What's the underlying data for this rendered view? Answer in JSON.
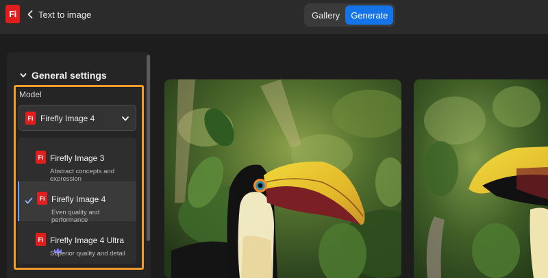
{
  "header": {
    "logo_text": "Fi",
    "title": "Text to image",
    "tabs": [
      {
        "label": "Gallery",
        "active": false
      },
      {
        "label": "Generate",
        "active": true
      }
    ]
  },
  "settings": {
    "section_title": "General settings",
    "model_label": "Model",
    "selected_model": "Firefly Image 4",
    "options": [
      {
        "name": "Firefly Image 3",
        "description": "Abstract concepts and expression",
        "selected": false
      },
      {
        "name": "Firefly Image 4",
        "description": "Even quality and performance",
        "selected": true
      },
      {
        "name": "Firefly Image 4 Ultra",
        "description": "Superior quality and detail",
        "selected": false,
        "premium_icon": "crown-icon"
      }
    ]
  },
  "colors": {
    "accent": "#1473e6",
    "brand": "#e01e1e",
    "highlight_border": "#f39a2d",
    "premium": "#7b7bf5"
  },
  "images": [
    {
      "subject": "toucan"
    },
    {
      "subject": "toucan"
    }
  ]
}
